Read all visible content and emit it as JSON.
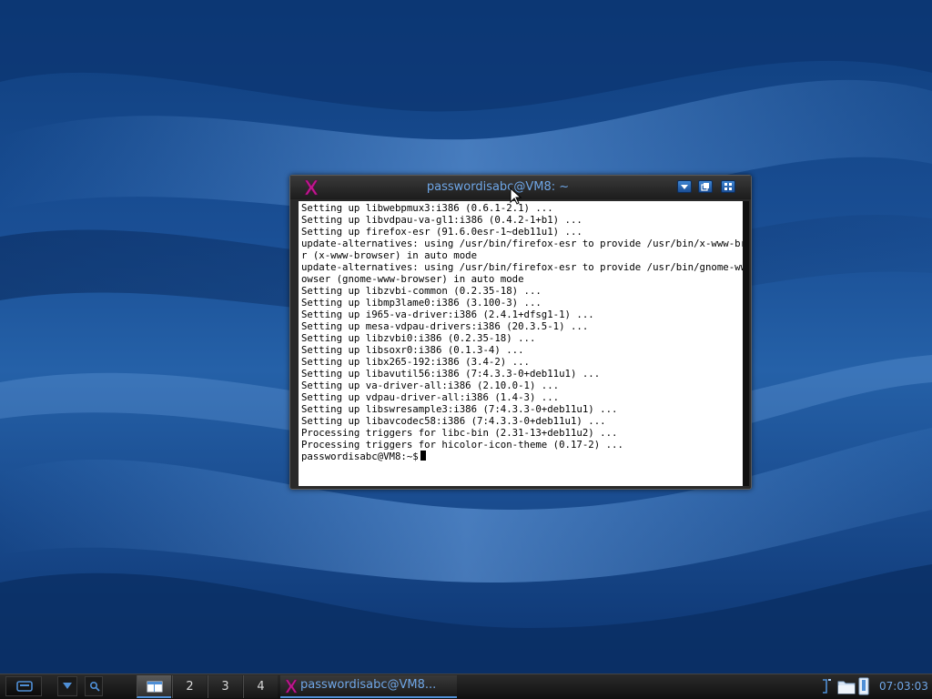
{
  "terminal": {
    "title": "passwordisabc@VM8: ~",
    "lines": [
      "Setting up libwebpmux3:i386 (0.6.1-2.1) ...",
      "Setting up libvdpau-va-gl1:i386 (0.4.2-1+b1) ...",
      "Setting up firefox-esr (91.6.0esr-1~deb11u1) ...",
      "update-alternatives: using /usr/bin/firefox-esr to provide /usr/bin/x-www-browse",
      "r (x-www-browser) in auto mode",
      "update-alternatives: using /usr/bin/firefox-esr to provide /usr/bin/gnome-www-br",
      "owser (gnome-www-browser) in auto mode",
      "Setting up libzvbi-common (0.2.35-18) ...",
      "Setting up libmp3lame0:i386 (3.100-3) ...",
      "Setting up i965-va-driver:i386 (2.4.1+dfsg1-1) ...",
      "Setting up mesa-vdpau-drivers:i386 (20.3.5-1) ...",
      "Setting up libzvbi0:i386 (0.2.35-18) ...",
      "Setting up libsoxr0:i386 (0.1.3-4) ...",
      "Setting up libx265-192:i386 (3.4-2) ...",
      "Setting up libavutil56:i386 (7:4.3.3-0+deb11u1) ...",
      "Setting up va-driver-all:i386 (2.10.0-1) ...",
      "Setting up vdpau-driver-all:i386 (1.4-3) ...",
      "Setting up libswresample3:i386 (7:4.3.3-0+deb11u1) ...",
      "Setting up libavcodec58:i386 (7:4.3.3-0+deb11u1) ...",
      "Processing triggers for libc-bin (2.31-13+deb11u2) ...",
      "Processing triggers for hicolor-icon-theme (0.17-2) ..."
    ],
    "prompt": "passwordisabc@VM8:~$"
  },
  "taskbar": {
    "workspaces": [
      "2",
      "3",
      "4"
    ],
    "task_label": "passwordisabc@VM8...",
    "clock": "07:03:03"
  },
  "icons": {
    "app": "x-terminal-icon",
    "minimize": "chevron-down-icon",
    "maximize": "window-restore-icon",
    "close": "grid-icon",
    "menu": "menu-icon",
    "show_desktop": "triangle-down-icon",
    "search": "search-icon",
    "workspace_active": "window-icon",
    "volume": "volume-icon",
    "files": "folder-icon",
    "network": "network-icon"
  },
  "colors": {
    "title_text": "#6fa6e6",
    "accent": "#4f8fd6"
  }
}
